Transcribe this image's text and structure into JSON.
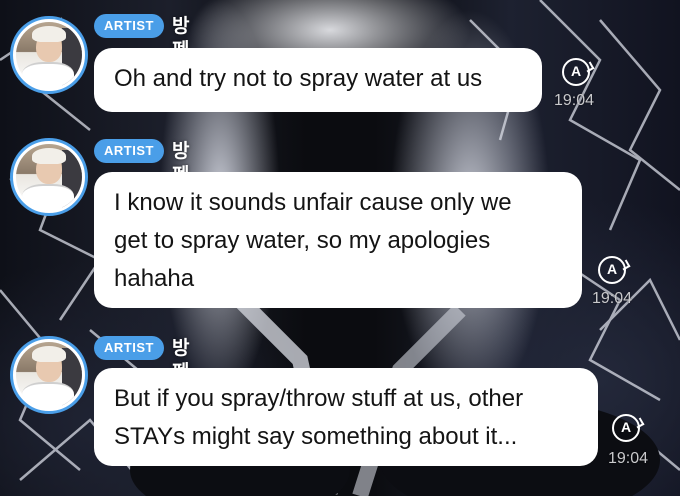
{
  "theme": {
    "accent": "#4a9ee8",
    "bubble": "#ffffff",
    "text": "#141414"
  },
  "messages": [
    {
      "badge": "ARTIST",
      "sender": "방펜디",
      "text": "Oh and try not to spray water at us",
      "translate_icon": "translate-icon",
      "translate_glyph": "A",
      "time": "19:04"
    },
    {
      "badge": "ARTIST",
      "sender": "방펜디",
      "text": "I know it sounds unfair cause only we\nget to spray water, so my apologies\nhahaha",
      "translate_icon": "translate-icon",
      "translate_glyph": "A",
      "time": "19:04"
    },
    {
      "badge": "ARTIST",
      "sender": "방펜디",
      "text": "But if you spray/throw stuff at us, other\nSTAYs might say something about it...",
      "translate_icon": "translate-icon",
      "translate_glyph": "A",
      "time": "19:04"
    }
  ]
}
